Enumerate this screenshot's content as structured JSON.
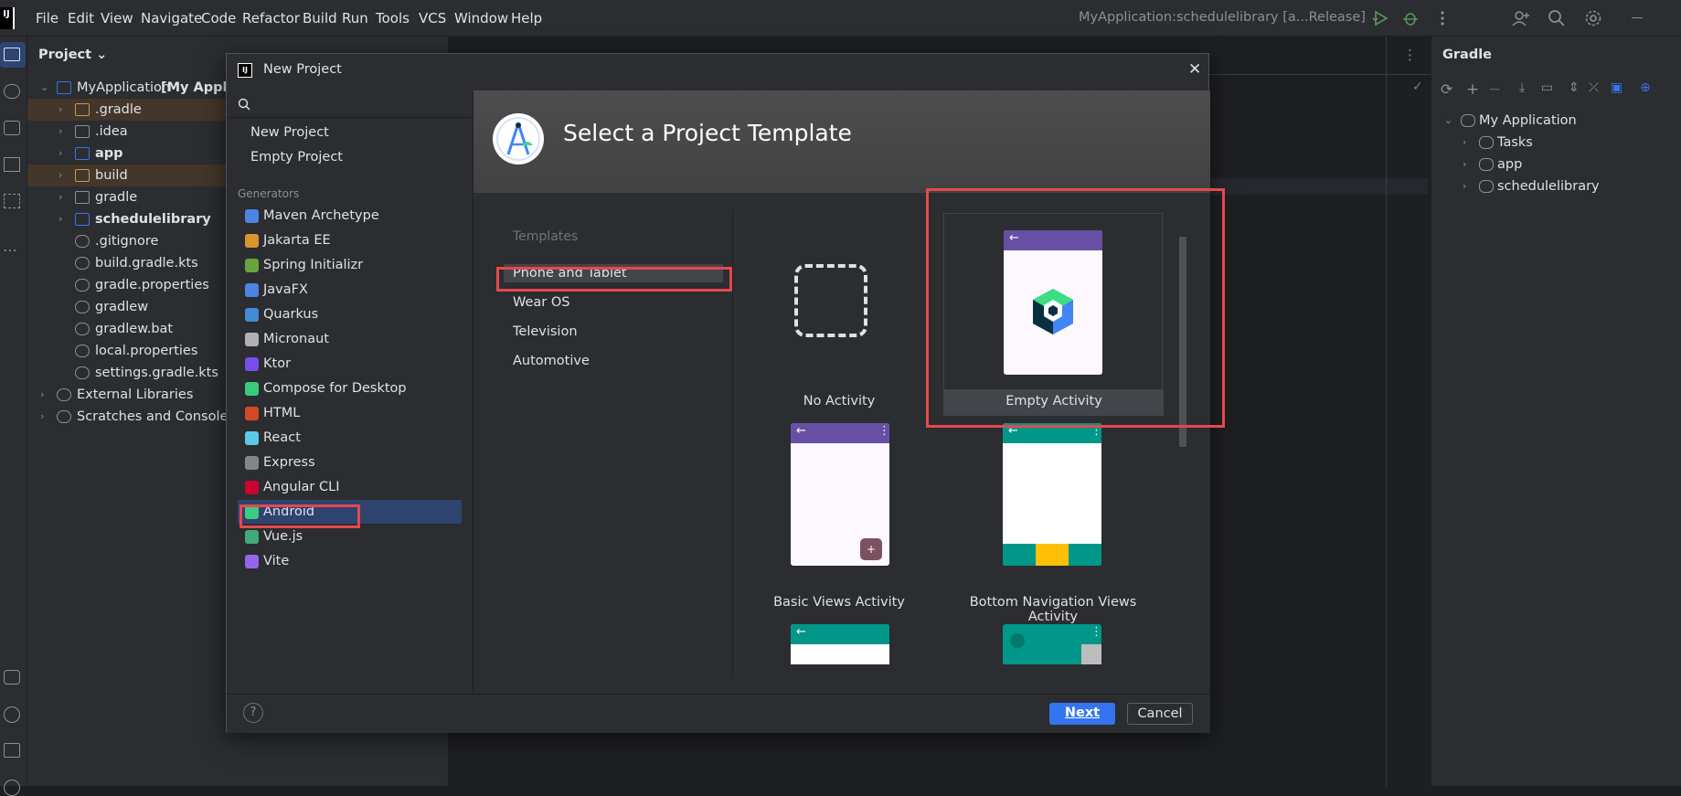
{
  "menu": [
    "File",
    "Edit",
    "View",
    "Navigate",
    "Code",
    "Refactor",
    "Build",
    "Run",
    "Tools",
    "VCS",
    "Window",
    "Help"
  ],
  "run_config": "MyApplication:schedulelibrary [a...Release]",
  "project_panel": {
    "title": "Project",
    "tree": [
      {
        "label": "MyApplication",
        "suffix": "[My Applica",
        "level": 0,
        "expanded": true,
        "icon": "module-folder-icon"
      },
      {
        "label": ".gradle",
        "level": 1,
        "icon": "folder-orange-icon",
        "highlight": true
      },
      {
        "label": ".idea",
        "level": 1,
        "icon": "folder-icon"
      },
      {
        "label": "app",
        "level": 1,
        "icon": "module-folder-icon",
        "bold": true
      },
      {
        "label": "build",
        "level": 1,
        "icon": "folder-orange-icon",
        "highlight": true
      },
      {
        "label": "gradle",
        "level": 1,
        "icon": "folder-icon"
      },
      {
        "label": "schedulelibrary",
        "level": 1,
        "icon": "module-folder-icon",
        "bold": true
      },
      {
        "label": ".gitignore",
        "level": 1,
        "icon": "gitignore-icon",
        "leaf": true
      },
      {
        "label": "build.gradle.kts",
        "level": 1,
        "icon": "gradle-file-icon",
        "leaf": true
      },
      {
        "label": "gradle.properties",
        "level": 1,
        "icon": "settings-file-icon",
        "leaf": true
      },
      {
        "label": "gradlew",
        "level": 1,
        "icon": "text-file-icon",
        "leaf": true
      },
      {
        "label": "gradlew.bat",
        "level": 1,
        "icon": "text-file-icon",
        "leaf": true
      },
      {
        "label": "local.properties",
        "level": 1,
        "icon": "settings-file-icon",
        "leaf": true
      },
      {
        "label": "settings.gradle.kts",
        "level": 1,
        "icon": "gradle-file-icon",
        "leaf": true
      },
      {
        "label": "External Libraries",
        "level": 0,
        "icon": "libraries-icon"
      },
      {
        "label": "Scratches and Consoles",
        "level": 0,
        "icon": "scratches-icon"
      }
    ]
  },
  "gradle_panel": {
    "title": "Gradle",
    "tree": [
      {
        "label": "My Application",
        "level": 0,
        "expanded": true
      },
      {
        "label": "Tasks",
        "level": 1
      },
      {
        "label": "app",
        "level": 1
      },
      {
        "label": "schedulelibrary",
        "level": 1
      }
    ]
  },
  "dialog": {
    "title": "New Project",
    "top_items": [
      "New Project",
      "Empty Project"
    ],
    "generators_label": "Generators",
    "generators": [
      {
        "label": "Maven Archetype",
        "icon": "maven-icon"
      },
      {
        "label": "Jakarta EE",
        "icon": "jakarta-icon"
      },
      {
        "label": "Spring Initializr",
        "icon": "spring-icon"
      },
      {
        "label": "JavaFX",
        "icon": "javafx-icon"
      },
      {
        "label": "Quarkus",
        "icon": "quarkus-icon"
      },
      {
        "label": "Micronaut",
        "icon": "micronaut-icon"
      },
      {
        "label": "Ktor",
        "icon": "ktor-icon"
      },
      {
        "label": "Compose for Desktop",
        "icon": "compose-icon"
      },
      {
        "label": "HTML",
        "icon": "html-icon"
      },
      {
        "label": "React",
        "icon": "react-icon"
      },
      {
        "label": "Express",
        "icon": "express-icon"
      },
      {
        "label": "Angular CLI",
        "icon": "angular-icon"
      },
      {
        "label": "Android",
        "icon": "android-icon",
        "selected": true
      },
      {
        "label": "Vue.js",
        "icon": "vue-icon"
      },
      {
        "label": "Vite",
        "icon": "vite-icon"
      }
    ],
    "hero_title": "Select a Project Template",
    "templates_label": "Templates",
    "categories": [
      "Phone and Tablet",
      "Wear OS",
      "Television",
      "Automotive"
    ],
    "templates": [
      "No Activity",
      "Empty Activity",
      "Basic Views Activity",
      "Bottom Navigation Views Activity"
    ],
    "help_label": "?",
    "next_label": "Next",
    "cancel_label": "Cancel"
  },
  "colors": {
    "accent": "#3574f0",
    "highlight_red": "#e5494d",
    "purple": "#6750a4",
    "teal": "#009688",
    "selection": "#2e436e"
  }
}
